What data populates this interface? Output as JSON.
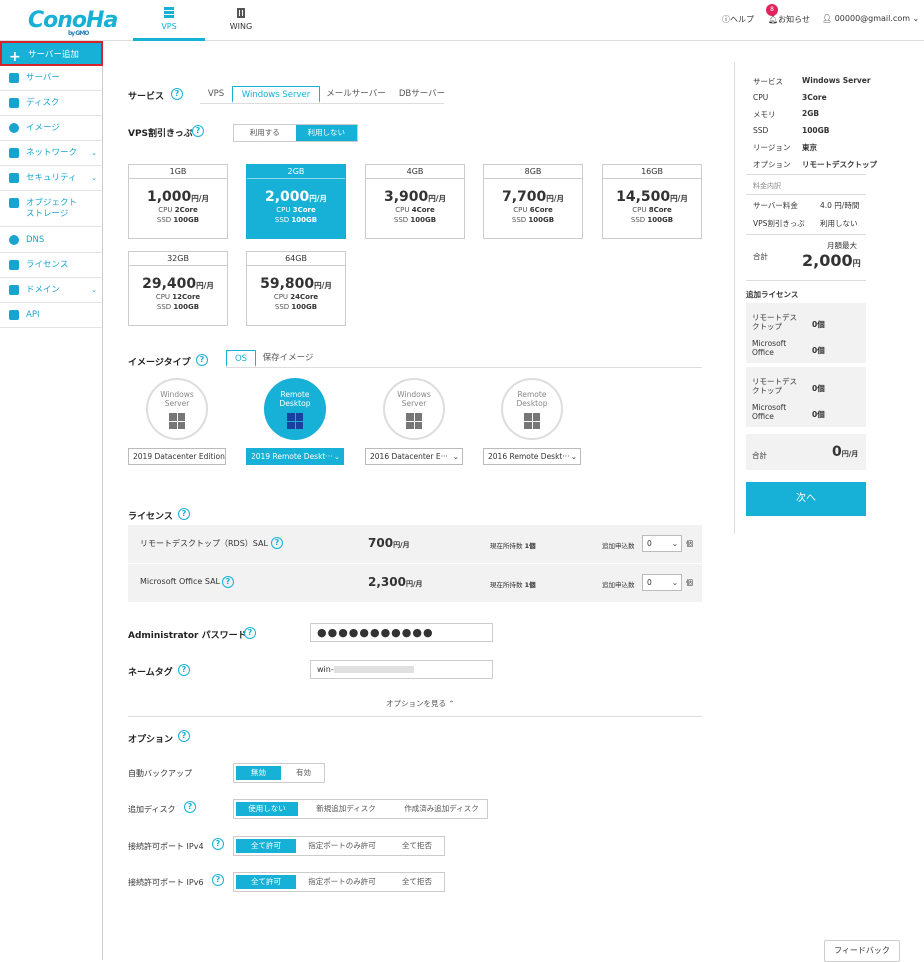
{
  "header": {
    "logo": "ConoHa",
    "logo_sub": "by GMO",
    "tabs": [
      {
        "label": "VPS"
      },
      {
        "label": "WING"
      }
    ],
    "help": "ヘルプ",
    "notifications": "お知らせ",
    "notif_count": "8",
    "user": "00000@gmail.com"
  },
  "sidebar": {
    "items": [
      {
        "label": "サーバー追加"
      },
      {
        "label": "サーバー"
      },
      {
        "label": "ディスク"
      },
      {
        "label": "イメージ"
      },
      {
        "label": "ネットワーク"
      },
      {
        "label": "セキュリティ"
      },
      {
        "label": "オブジェクト\nストレージ"
      },
      {
        "label": "DNS"
      },
      {
        "label": "ライセンス"
      },
      {
        "label": "ドメイン"
      },
      {
        "label": "API"
      }
    ]
  },
  "service": {
    "label": "サービス",
    "tabs": [
      "VPS",
      "Windows Server",
      "メールサーバー",
      "DBサーバー"
    ]
  },
  "discount": {
    "label": "VPS割引きっぷ",
    "options": [
      "利用する",
      "利用しない"
    ]
  },
  "plans": [
    {
      "name": "1GB",
      "price": "1,000",
      "unit": "円/月",
      "cpu": "2Core",
      "ssd": "100GB"
    },
    {
      "name": "2GB",
      "price": "2,000",
      "unit": "円/月",
      "cpu": "3Core",
      "ssd": "100GB"
    },
    {
      "name": "4GB",
      "price": "3,900",
      "unit": "円/月",
      "cpu": "4Core",
      "ssd": "100GB"
    },
    {
      "name": "8GB",
      "price": "7,700",
      "unit": "円/月",
      "cpu": "6Core",
      "ssd": "100GB"
    },
    {
      "name": "16GB",
      "price": "14,500",
      "unit": "円/月",
      "cpu": "8Core",
      "ssd": "100GB"
    },
    {
      "name": "32GB",
      "price": "29,400",
      "unit": "円/月",
      "cpu": "12Core",
      "ssd": "100GB"
    },
    {
      "name": "64GB",
      "price": "59,800",
      "unit": "円/月",
      "cpu": "24Core",
      "ssd": "100GB"
    }
  ],
  "plan_labels": {
    "cpu": "CPU",
    "ssd": "SSD"
  },
  "image": {
    "label": "イメージタイプ",
    "tabs": [
      "OS",
      "保存イメージ"
    ],
    "cards": [
      {
        "line1": "Windows",
        "line2": "Server",
        "select": "2019 Datacenter Edition"
      },
      {
        "line1": "Remote",
        "line2": "Desktop",
        "select": "2019 Remote Deskt···"
      },
      {
        "line1": "Windows",
        "line2": "Server",
        "select": "2016 Datacenter E···"
      },
      {
        "line1": "Remote",
        "line2": "Desktop",
        "select": "2016 Remote Deskt···"
      }
    ]
  },
  "license": {
    "label": "ライセンス",
    "rows": [
      {
        "name": "リモートデスクトップ（RDS）SAL",
        "price": "700",
        "unit": "円/月",
        "owned_label": "現在所持数",
        "owned": "1個",
        "add_label": "追加申込数",
        "add": "0",
        "add_unit": "個"
      },
      {
        "name": "Microsoft Office SAL",
        "price": "2,300",
        "unit": "円/月",
        "owned_label": "現在所持数",
        "owned": "1個",
        "add_label": "追加申込数",
        "add": "0",
        "add_unit": "個"
      }
    ]
  },
  "admin_pw": {
    "label": "Administrator パスワード",
    "value": "●●●●●●●●●●●"
  },
  "nametag": {
    "label": "ネームタグ",
    "value": "win-"
  },
  "show_options": "オプションを見る",
  "options": {
    "label": "オプション",
    "rows": [
      {
        "label": "自動バックアップ",
        "choices": [
          "無効",
          "有効"
        ]
      },
      {
        "label": "追加ディスク",
        "choices": [
          "使用しない",
          "新規追加ディスク",
          "作成済み追加ディスク"
        ]
      },
      {
        "label": "接続許可ポート IPv4",
        "choices": [
          "全て許可",
          "指定ポートのみ許可",
          "全て拒否"
        ]
      },
      {
        "label": "接続許可ポート IPv6",
        "choices": [
          "全て許可",
          "指定ポートのみ許可",
          "全て拒否"
        ]
      }
    ]
  },
  "summary": {
    "rows": [
      {
        "k": "サービス",
        "v": "Windows Server"
      },
      {
        "k": "CPU",
        "v": "3Core"
      },
      {
        "k": "メモリ",
        "v": "2GB"
      },
      {
        "k": "SSD",
        "v": "100GB"
      },
      {
        "k": "リージョン",
        "v": "東京"
      },
      {
        "k": "オプション",
        "v": "リモートデスクトップ"
      }
    ],
    "fee_title": "料金内訳",
    "fees": [
      {
        "k": "サーバー料金",
        "v": "4.0 円/時間"
      },
      {
        "k": "VPS割引きっぷ",
        "v": "利用しない"
      }
    ],
    "total_label": "合計",
    "monthly_max": "月額最大",
    "total": "2,000",
    "total_unit": "円",
    "addlic_title": "追加ライセンス",
    "lic_blocks": [
      [
        {
          "k": "リモートデスクトップ",
          "v": "0個"
        },
        {
          "k": "Microsoft Office",
          "v": "0個"
        }
      ],
      [
        {
          "k": "リモートデスクトップ",
          "v": "0個"
        },
        {
          "k": "Microsoft Office",
          "v": "0個"
        }
      ]
    ],
    "lic_total_label": "合計",
    "lic_total": "0",
    "lic_total_unit": "円/月",
    "next": "次へ"
  },
  "feedback": "フィードバック"
}
